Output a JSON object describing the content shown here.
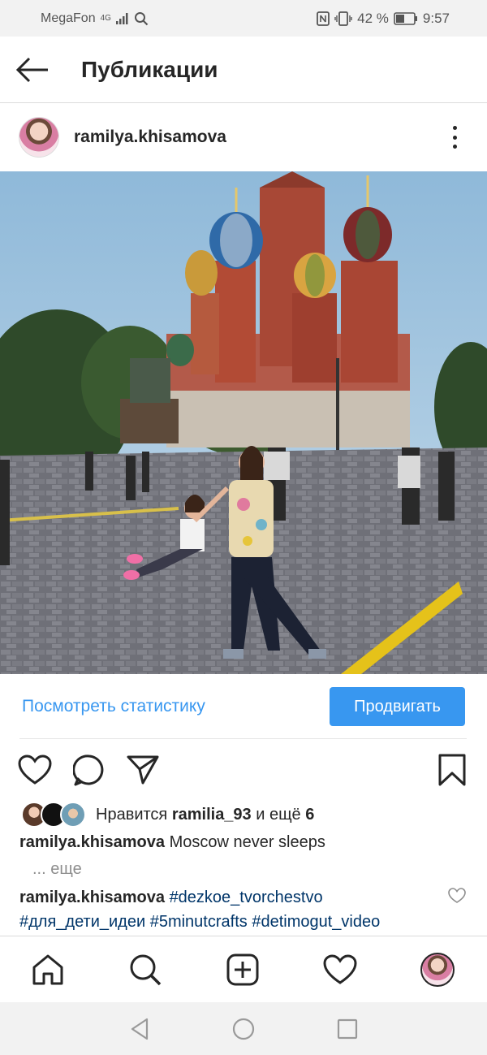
{
  "status_bar": {
    "carrier": "MegaFon",
    "network": "4G",
    "battery_percent": "42 %",
    "time": "9:57"
  },
  "header": {
    "title": "Публикации"
  },
  "post": {
    "username": "ramilya.khisamova",
    "promote": {
      "stats_link": "Посмотреть статистику",
      "promote_button": "Продвигать"
    },
    "likes": {
      "prefix": "Нравится",
      "liker": "ramilia_93",
      "suffix": "и ещё",
      "others": "6"
    },
    "caption": {
      "username": "ramilya.khisamova",
      "text": "Moscow never sleeps",
      "more": "... еще"
    },
    "comment": {
      "username": "ramilya.khisamova",
      "hashtags": [
        "#dezkoe_tvorchestvo",
        "#для_дети_идеи",
        "#5minutcrafts",
        "#detimogut_video"
      ]
    }
  },
  "colors": {
    "accent": "#3897f0",
    "text": "#262626",
    "hashtag": "#003569"
  },
  "icons": {
    "back": "arrow-left-icon",
    "more": "more-vertical-icon",
    "like": "heart-icon",
    "comment": "comment-icon",
    "share": "send-icon",
    "save": "bookmark-icon",
    "home": "home-icon",
    "search": "search-icon",
    "add": "add-post-icon",
    "activity": "heart-icon"
  }
}
